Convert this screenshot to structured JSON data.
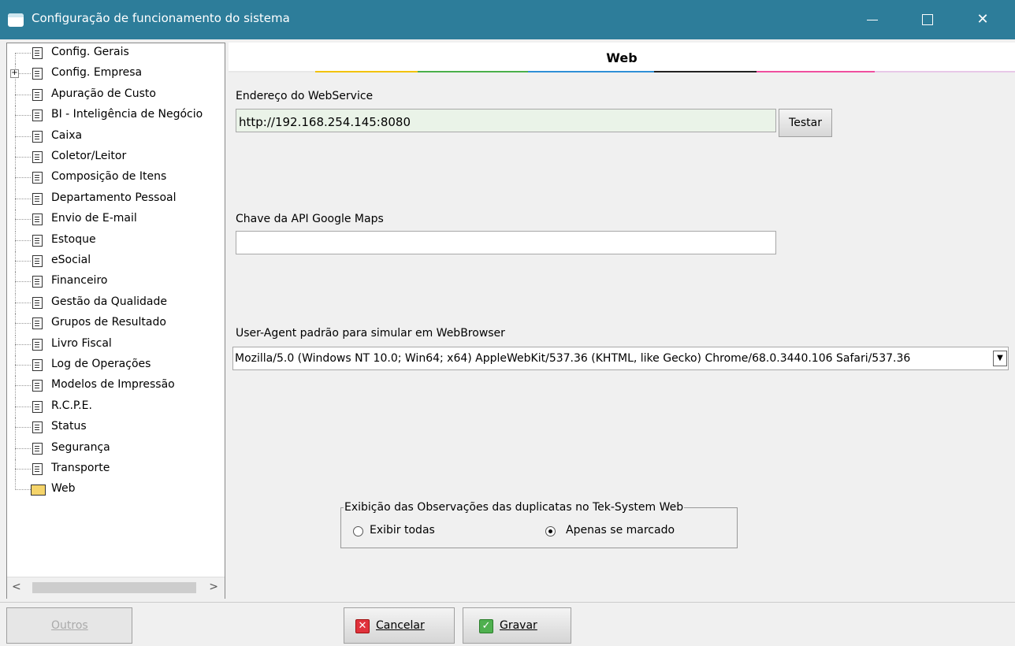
{
  "window": {
    "title": "Configuração de funcionamento do sistema",
    "controls": {
      "minimize": "minimize-icon",
      "maximize": "maximize-icon",
      "close": "✕"
    }
  },
  "sidebar": {
    "items": [
      {
        "label": "Config. Gerais",
        "icon": "document-icon"
      },
      {
        "label": "Config. Empresa",
        "icon": "document-icon",
        "expandable": true
      },
      {
        "label": "Apuração de Custo",
        "icon": "document-icon"
      },
      {
        "label": "BI - Inteligência de Negócio",
        "icon": "document-icon"
      },
      {
        "label": "Caixa",
        "icon": "document-icon"
      },
      {
        "label": "Coletor/Leitor",
        "icon": "document-icon"
      },
      {
        "label": "Composição de Itens",
        "icon": "document-icon"
      },
      {
        "label": "Departamento Pessoal",
        "icon": "document-icon"
      },
      {
        "label": "Envio de E-mail",
        "icon": "document-icon"
      },
      {
        "label": "Estoque",
        "icon": "document-icon"
      },
      {
        "label": "eSocial",
        "icon": "document-icon"
      },
      {
        "label": "Financeiro",
        "icon": "document-icon"
      },
      {
        "label": "Gestão da Qualidade",
        "icon": "document-icon"
      },
      {
        "label": "Grupos de Resultado",
        "icon": "document-icon"
      },
      {
        "label": "Livro Fiscal",
        "icon": "document-icon"
      },
      {
        "label": "Log de Operações",
        "icon": "document-icon"
      },
      {
        "label": "Modelos de Impressão",
        "icon": "document-icon"
      },
      {
        "label": "R.C.P.E.",
        "icon": "document-icon"
      },
      {
        "label": "Status",
        "icon": "document-icon"
      },
      {
        "label": "Segurança",
        "icon": "document-icon"
      },
      {
        "label": "Transporte",
        "icon": "document-icon"
      },
      {
        "label": "Web",
        "icon": "folder-open-icon",
        "selected": true
      }
    ],
    "scroll_left": "<",
    "scroll_right": ">"
  },
  "panel": {
    "title": "Web",
    "webservice": {
      "label": "Endereço do WebService",
      "value": "http://192.168.254.145:8080",
      "test_button": "Testar"
    },
    "google_maps": {
      "label": "Chave da API Google Maps",
      "value": ""
    },
    "user_agent": {
      "label": "User-Agent padrão para simular em WebBrowser",
      "value": "Mozilla/5.0 (Windows NT 10.0; Win64; x64) AppleWebKit/537.36 (KHTML, like Gecko) Chrome/68.0.3440.106 Safari/537.36"
    },
    "observations_group": {
      "legend": "Exibição das Observações das duplicatas no Tek-System Web",
      "options": [
        "Exibir todas",
        "Apenas se marcado"
      ],
      "selected": "Apenas se marcado"
    }
  },
  "footer": {
    "others_button": "Outros",
    "cancel_button": "Cancelar",
    "save_button": "Gravar"
  },
  "colors": {
    "titlebar": "#2d7d9a",
    "field_green": "#eaf3e8"
  }
}
